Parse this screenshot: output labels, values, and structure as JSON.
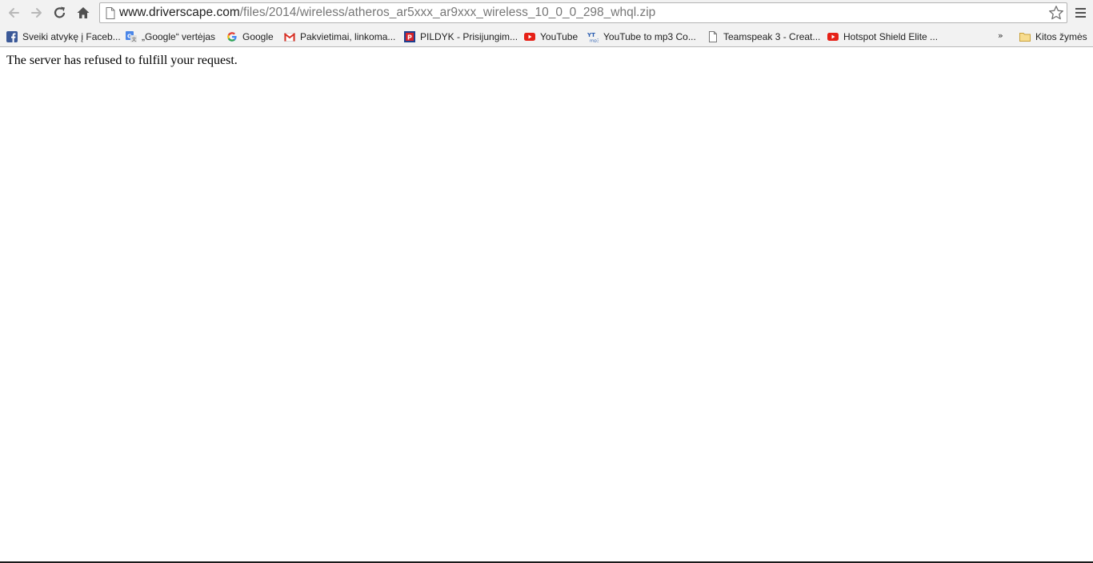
{
  "toolbar": {
    "back_icon": "back-arrow-icon",
    "forward_icon": "forward-arrow-icon",
    "reload_icon": "reload-icon",
    "home_icon": "home-icon",
    "menu_icon": "hamburger-menu-icon"
  },
  "omnibox": {
    "url_host": "www.driverscape.com",
    "url_path": "/files/2014/wireless/atheros_ar5xxx_ar9xxx_wireless_10_0_0_298_whql.zip",
    "page_icon": "page-icon",
    "star_icon": "bookmark-star-icon"
  },
  "bookmarks": {
    "items": [
      {
        "label": "Sveiki atvykę į Faceb...",
        "icon": "facebook-icon",
        "color": "#3b5998"
      },
      {
        "label": "„Google“ vertėjas",
        "icon": "google-translate-icon",
        "color": "#4a86e8"
      },
      {
        "label": "Google",
        "icon": "google-icon",
        "color": "#4285f4"
      },
      {
        "label": "Pakvietimai, linkoma...",
        "icon": "gmail-icon",
        "color": "#d93025"
      },
      {
        "label": "PILDYK - Prisijungim...",
        "icon": "pildyk-icon",
        "color": "#1e3f8f"
      },
      {
        "label": "YouTube",
        "icon": "youtube-icon",
        "color": "#e62117"
      },
      {
        "label": "YouTube to mp3 Co...",
        "icon": "youtube-mp3-icon",
        "color": "#2a5db0"
      },
      {
        "label": "Teamspeak 3 - Creat...",
        "icon": "page-icon",
        "color": "#777777"
      },
      {
        "label": "Hotspot Shield Elite ...",
        "icon": "youtube-icon",
        "color": "#e62117"
      }
    ],
    "overflow": "»",
    "other_folder": {
      "label": "Kitos žymės",
      "icon": "folder-icon",
      "color": "#e8c36a"
    }
  },
  "page": {
    "message": "The server has refused to fulfill your request."
  }
}
